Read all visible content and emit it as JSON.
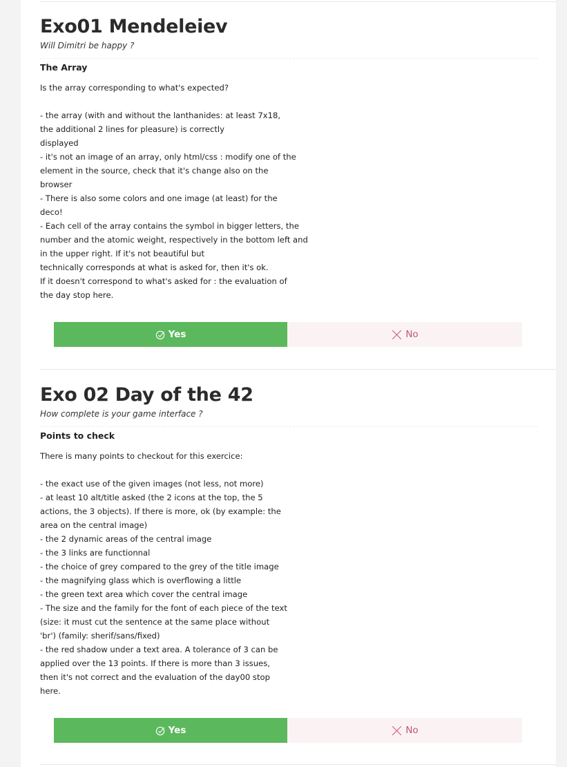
{
  "colors": {
    "yes_bg": "#5cb85c",
    "no_bg": "#fbf3f3",
    "no_text": "#c0567a"
  },
  "exercises": [
    {
      "title": "Exo01 Mendeleiev",
      "subtitle": "Will Dimitri be happy ?",
      "block_title": "The Array",
      "lines": [
        "Is the array corresponding to what's expected?",
        "",
        "- the array (with and without the lanthanides: at least 7x18,",
        "the additional 2 lines for pleasure) is correctly",
        "displayed",
        "- it's not an image of an array, only html/css : modify one of the",
        "element in the source, check that it's change also on the",
        "browser",
        "- There is also some colors and one image (at least) for the",
        "deco!",
        "- Each cell of the array contains the symbol in bigger letters, the",
        "number and the atomic weight, respectively in the bottom left and",
        "in the upper right. If it's not beautiful but",
        "technically corresponds at what is asked for, then it's ok.",
        "If it doesn't correspond to what's asked for : the evaluation of",
        "the day stop here."
      ],
      "yes_label": "Yes",
      "no_label": "No",
      "yes_icon": "check-circle-icon",
      "no_icon": "x-icon"
    },
    {
      "title": "Exo 02 Day of the 42",
      "subtitle": "How complete is your game interface ?",
      "block_title": "Points to check",
      "lines": [
        "There is many points to checkout for this exercice:",
        "",
        "- the exact use of the given images (not less, not more)",
        "- at least 10 alt/title asked (the 2 icons at the top, the 5",
        "actions, the 3 objects). If there is more, ok (by example: the",
        "area on the central image)",
        "- the 2 dynamic areas of the central image",
        "- the 3 links are functionnal",
        "- the choice of grey compared to the grey of the title image",
        "- the magnifying glass which is overflowing a little",
        "- the green text area which cover the central image",
        "- The size and the family for the font of each piece of the text",
        "(size: it must cut the sentence at the same place without",
        "'br') (family: sherif/sans/fixed)",
        "- the red shadow under a text area. A tolerance of 3 can be",
        "applied over the 13 points. If there is more than 3 issues,",
        "then it's not correct and the evaluation of the day00 stop",
        "here."
      ],
      "yes_label": "Yes",
      "no_label": "No",
      "yes_icon": "check-circle-icon",
      "no_icon": "x-icon"
    }
  ]
}
